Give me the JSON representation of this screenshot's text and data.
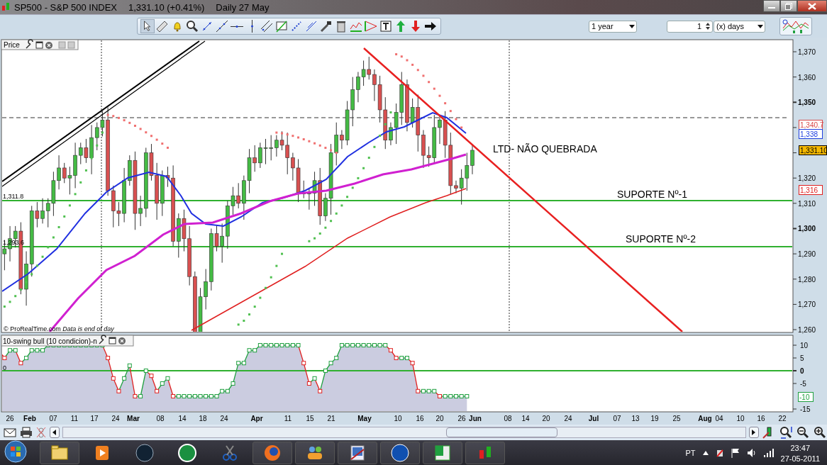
{
  "window": {
    "title": "SP500 - S&P 500 INDEX",
    "quote": "1,331.10 (+0.41%)",
    "period": "Daily  27 May"
  },
  "toolbar": {
    "range": {
      "value": "1 year"
    },
    "count": {
      "value": "1"
    },
    "unit": {
      "value": "(x) days"
    }
  },
  "price_panel": {
    "title": "Price",
    "credit": "© ProRealTime.com",
    "credit_note": "Data is end of day",
    "y_labels": [
      {
        "label": "1,370",
        "major": false
      },
      {
        "label": "1,360",
        "major": false
      },
      {
        "label": "1,350",
        "major": true
      },
      {
        "label": "1,320",
        "major": false
      },
      {
        "label": "1,310",
        "major": false
      },
      {
        "label": "1,300",
        "major": true
      },
      {
        "label": "1,290",
        "major": false
      },
      {
        "label": "1,280",
        "major": false
      },
      {
        "label": "1,270",
        "major": false
      },
      {
        "label": "1,260",
        "major": false
      }
    ],
    "markers": [
      {
        "label": "1,340.7",
        "color": "#d84848",
        "highlighted": false
      },
      {
        "label": "1,338",
        "color": "#2040e0",
        "highlighted": false
      },
      {
        "label": "1,331.10",
        "color": "#000000",
        "highlighted": true
      },
      {
        "label": "1,316",
        "color": "#e02020",
        "highlighted": false
      }
    ],
    "line_labels": [
      "1,311.8",
      "1,293.6"
    ],
    "annotations": [
      "LTD- NÃO QUEBRADA",
      "SUPORTE Nº-1",
      "SUPORTE Nº-2"
    ]
  },
  "indicator_panel": {
    "title": "10-swing bull (10 condicion)-n",
    "zero_label": "0",
    "y_labels": [
      {
        "label": "10",
        "major": false
      },
      {
        "label": "5",
        "major": false
      },
      {
        "label": "0",
        "major": true
      },
      {
        "label": "-5",
        "major": false
      },
      {
        "label": "-15",
        "major": false
      }
    ],
    "marker": {
      "label": "-10",
      "color": "#20a040"
    }
  },
  "date_axis": [
    {
      "label": "26",
      "major": false
    },
    {
      "label": "Feb",
      "major": true
    },
    {
      "label": "07",
      "major": false
    },
    {
      "label": "11",
      "major": false
    },
    {
      "label": "17",
      "major": false
    },
    {
      "label": "24",
      "major": false
    },
    {
      "label": "Mar",
      "major": true
    },
    {
      "label": "08",
      "major": false
    },
    {
      "label": "14",
      "major": false
    },
    {
      "label": "18",
      "major": false
    },
    {
      "label": "24",
      "major": false
    },
    {
      "label": "Apr",
      "major": true
    },
    {
      "label": "11",
      "major": false
    },
    {
      "label": "15",
      "major": false
    },
    {
      "label": "21",
      "major": false
    },
    {
      "label": "May",
      "major": true
    },
    {
      "label": "10",
      "major": false
    },
    {
      "label": "16",
      "major": false
    },
    {
      "label": "20",
      "major": false
    },
    {
      "label": "26",
      "major": false
    },
    {
      "label": "Jun",
      "major": true
    },
    {
      "label": "08",
      "major": false
    },
    {
      "label": "14",
      "major": false
    },
    {
      "label": "20",
      "major": false
    },
    {
      "label": "24",
      "major": false
    },
    {
      "label": "Jul",
      "major": true
    },
    {
      "label": "07",
      "major": false
    },
    {
      "label": "13",
      "major": false
    },
    {
      "label": "19",
      "major": false
    },
    {
      "label": "25",
      "major": false
    },
    {
      "label": "Aug",
      "major": true
    },
    {
      "label": "04",
      "major": false
    },
    {
      "label": "10",
      "major": false
    },
    {
      "label": "16",
      "major": false
    },
    {
      "label": "22",
      "major": false
    }
  ],
  "taskbar": {
    "language": "PT",
    "time": "23:47",
    "date": "27-05-2011"
  }
}
